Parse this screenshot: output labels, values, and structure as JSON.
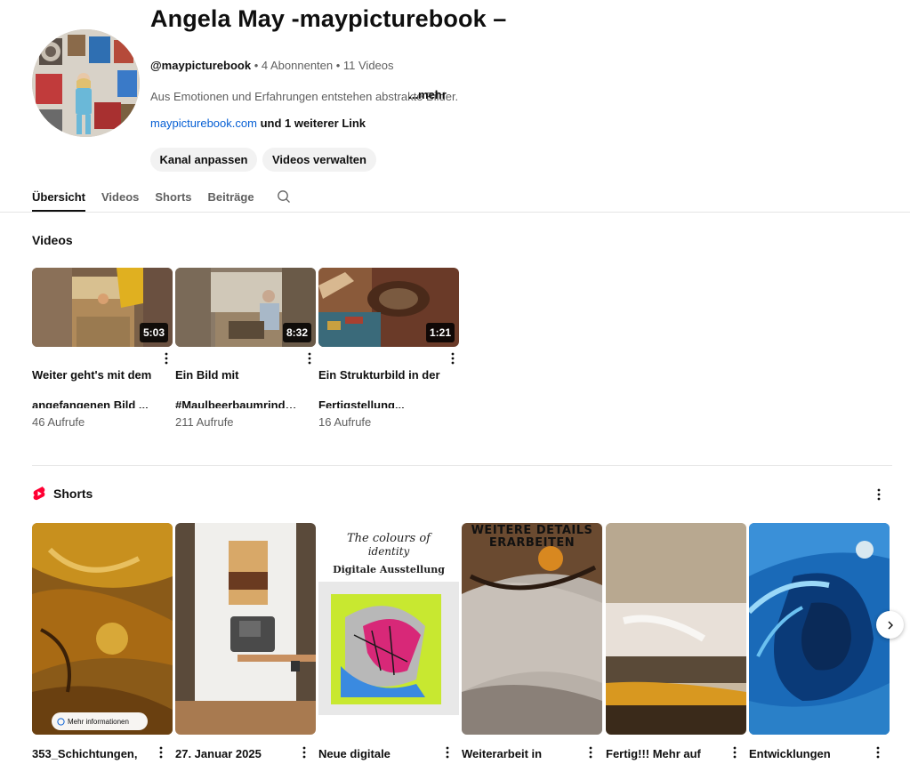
{
  "channel": {
    "title": "Angela May -maypicturebook –",
    "handle": "@maypicturebook",
    "subscribers": " • 4 Abonnenten • 11 Videos",
    "description": "Aus Emotionen und Erfahrungen entstehen abstrakte Bilder.",
    "more_label": "...mehr",
    "link_text": "maypicturebook.com",
    "link_more": " und 1 weiterer Link",
    "customize_button": "Kanal anpassen",
    "manage_button": "Videos verwalten"
  },
  "tabs": [
    {
      "label": "Übersicht",
      "active": true
    },
    {
      "label": "Videos",
      "active": false
    },
    {
      "label": "Shorts",
      "active": false
    },
    {
      "label": "Beiträge",
      "active": false
    }
  ],
  "videos_section": {
    "title": "Videos",
    "items": [
      {
        "line1": "Weiter geht's mit dem",
        "line2": "angefangenen Bild ...",
        "duration": "5:03",
        "views": "46 Aufrufe"
      },
      {
        "line1": "Ein Bild mit",
        "line2": "#Maulbeerbaumrinde...",
        "duration": "8:32",
        "views": "211 Aufrufe"
      },
      {
        "line1": "Ein Strukturbild in der",
        "line2": "Fertigstellung...",
        "duration": "1:21",
        "views": "16 Aufrufe"
      }
    ]
  },
  "shorts_section": {
    "title": "Shorts",
    "info_chip": "Mehr informationen",
    "poster_line1": "The colours of",
    "poster_line2": "identity",
    "poster_line3": "Digitale Ausstellung",
    "overlay_text": "WEITERE DETAILS ERARBEITEN",
    "items": [
      {
        "title": "353_Schichtungen,"
      },
      {
        "title": "27. Januar 2025"
      },
      {
        "title": "Neue digitale"
      },
      {
        "title": "Weiterarbeit in"
      },
      {
        "title": "Fertig!!! Mehr auf"
      },
      {
        "title": "Entwicklungen"
      }
    ]
  },
  "colors": {
    "link": "#065fd4",
    "shorts_red": "#ff0033",
    "chip_bg": "#f2f2f2"
  },
  "icons": {
    "search": "search-icon",
    "menu": "more-vert-icon",
    "shorts": "shorts-logo-icon",
    "next": "chevron-right-icon",
    "link": "link-icon"
  }
}
